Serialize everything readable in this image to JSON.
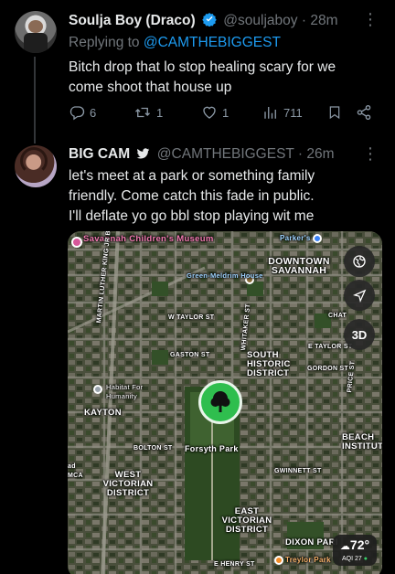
{
  "tweet1": {
    "display_name": "Soulja Boy (Draco)",
    "handle": "@souljaboy",
    "separator": "·",
    "time": "28m",
    "replying_prefix": "Replying to",
    "replying_handle": "@CAMTHEBIGGEST",
    "text_line1": "Bitch drop that lo stop healing scary for we",
    "text_line2": "come shoot that house up",
    "actions": {
      "replies": "6",
      "reposts": "1",
      "likes": "1",
      "views": "711"
    }
  },
  "tweet2": {
    "display_name": "BIG CAM",
    "handle": "@CAMTHEBIGGEST",
    "separator": "·",
    "time": "26m",
    "text_line1": "let's meet at a park or something family",
    "text_line2": "friendly. Come catch this fade in public.",
    "text_line3": "I'll deflate yo go bbl stop playing wit me"
  },
  "map": {
    "labels": {
      "savannah_childrens_museum": "Savannah Children's Museum",
      "parkers": "Parker's",
      "downtown_savannah": "DOWNTOWN SAVANNAH",
      "green_meldrim_house": "Green-Meldrim House",
      "martin_luther_king": "MARTIN LUTHER KING JR BLVD",
      "w_taylor_st": "W TAYLOR ST",
      "whitaker_st": "WHITAKER ST",
      "gaston_st": "GASTON ST",
      "south_historic_district": "SOUTH HISTORIC DISTRICT",
      "e_taylor_st": "E TAYLOR ST",
      "gordon_st": "GORDON ST",
      "habitat_for_humanity": "Habitat For Humanity",
      "kayton": "KAYTON",
      "bolton_st": "BOLTON ST",
      "forsyth_park": "Forsyth Park",
      "beach_institute": "BEACH INSTITUT",
      "west_victorian_district": "WEST VICTORIAN DISTRICT",
      "gwinnett_st": "GWINNETT ST",
      "east_victorian_district": "EAST VICTORIAN DISTRICT",
      "dixon_park": "DIXON PARI",
      "treylor_park": "Treylor Park",
      "henry_st": "E HENRY ST",
      "ad_mca": "ad MCA",
      "price_st": "PRICE ST",
      "chat": "CHAT"
    },
    "buttons": {
      "three_d": "3D"
    },
    "weather": {
      "temp": "72°",
      "aqi": "AQI 27"
    }
  }
}
